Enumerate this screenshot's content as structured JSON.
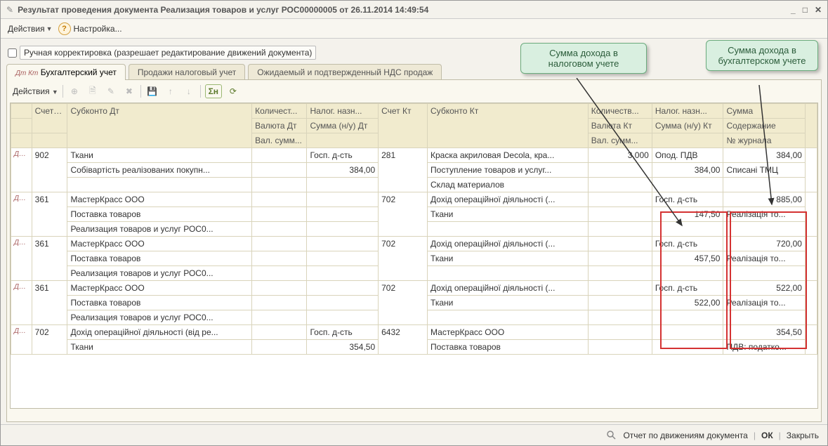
{
  "window": {
    "title": "Результат проведения документа Реализация товаров и услуг РОС00000005 от 26.11.2014 14:49:54"
  },
  "menubar": {
    "actions": "Действия",
    "settings": "Настройка..."
  },
  "manual_edit": {
    "label": "Ручная корректировка (разрешает редактирование движений документа)"
  },
  "tabs": {
    "t1": "Бухгалтерский учет",
    "t2": "Продажи налоговый учет",
    "t3": "Ожидаемый и подтвержденный НДС продаж"
  },
  "toolbar2": {
    "actions": "Действия"
  },
  "headers": {
    "r1": [
      "",
      "Счет Дт",
      "Субконто Дт",
      "Количест...",
      "Налог. назн...",
      "Счет Кт",
      "Субконто Кт",
      "Количеств...",
      "Налог. назн...",
      "Сумма",
      ""
    ],
    "r2": [
      "",
      "",
      "",
      "Валюта Дт",
      "Сумма (н/у) Дт",
      "",
      "",
      "Валюта Кт",
      "Сумма (н/у) Кт",
      "Содержание",
      ""
    ],
    "r3": [
      "",
      "",
      "",
      "Вал. сумм...",
      "",
      "",
      "",
      "Вал. сумм...",
      "",
      "№ журнала",
      ""
    ]
  },
  "rows": [
    {
      "mark": "Дт Кт",
      "acctDt": "902",
      "subDt": [
        "Ткани",
        "Собівартість реалізованих покупн..."
      ],
      "taxDt": [
        "Госп. д-сть",
        "384,00"
      ],
      "acctKt": "281",
      "subKt": [
        "Краска акриловая Decola, кра...",
        "Поступление товаров и услуг...",
        "Склад материалов"
      ],
      "qtyKt": "3,000",
      "taxKt": [
        "Опод. ПДВ",
        "384,00"
      ],
      "sum": [
        "384,00",
        "Списані ТМЦ"
      ]
    },
    {
      "mark": "Дт Кт",
      "acctDt": "361",
      "subDt": [
        " МастерКрасс ООО",
        "Поставка товаров",
        "Реализация товаров и услуг РОС0..."
      ],
      "taxDt": [],
      "acctKt": "702",
      "subKt": [
        "Дохід операційної діяльності (...",
        "Ткани"
      ],
      "qtyKt": "",
      "taxKt": [
        "Госп. д-сть",
        "147,50"
      ],
      "sum": [
        "885,00",
        "Реалізація то..."
      ]
    },
    {
      "mark": "Дт Кт",
      "acctDt": "361",
      "subDt": [
        " МастерКрасс ООО",
        "Поставка товаров",
        "Реализация товаров и услуг РОС0..."
      ],
      "taxDt": [],
      "acctKt": "702",
      "subKt": [
        "Дохід операційної діяльності (...",
        "Ткани"
      ],
      "qtyKt": "",
      "taxKt": [
        "Госп. д-сть",
        "457,50"
      ],
      "sum": [
        "720,00",
        "Реалізація то..."
      ]
    },
    {
      "mark": "Дт Кт",
      "acctDt": "361",
      "subDt": [
        " МастерКрасс ООО",
        "Поставка товаров",
        "Реализация товаров и услуг РОС0..."
      ],
      "taxDt": [],
      "acctKt": "702",
      "subKt": [
        "Дохід операційної діяльності (...",
        "Ткани"
      ],
      "qtyKt": "",
      "taxKt": [
        "Госп. д-сть",
        "522,00"
      ],
      "sum": [
        "522,00",
        "Реалізація то..."
      ]
    },
    {
      "mark": "Дт Кт",
      "acctDt": "702",
      "subDt": [
        "Дохід операційної діяльності (від ре...",
        "Ткани"
      ],
      "taxDt": [
        "Госп. д-сть",
        "354,50"
      ],
      "acctKt": "6432",
      "subKt": [
        " МастерКрасс ООО",
        "Поставка товаров"
      ],
      "qtyKt": "",
      "taxKt": [],
      "sum": [
        "354,50",
        "ПДВ: податко..."
      ]
    }
  ],
  "footer": {
    "report": "Отчет по движениям документа",
    "ok": "ОК",
    "close": "Закрыть"
  },
  "callouts": {
    "c1": "Сумма дохода в налоговом учете",
    "c2": "Сумма дохода в бухгалтерском учете"
  }
}
